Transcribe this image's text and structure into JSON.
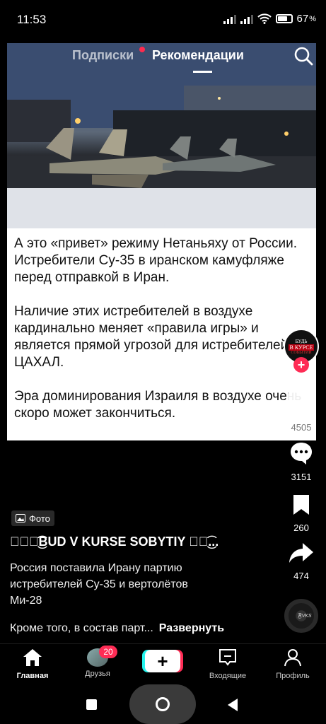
{
  "status_bar": {
    "time": "11:53",
    "battery": "67"
  },
  "tabs": {
    "subscriptions": "Подписки",
    "recommendations": "Рекомендации",
    "active": "recommendations"
  },
  "post": {
    "paragraphs": [
      "А это «привет» режиму Нетаньяху от России. Истребители Су-35 в иранском камуфляже перед отправкой в Иран.",
      "Наличие этих истребителей в воздухе кардинально меняет «правила игры» и является прямой угрозой для истребителей ЦАХАЛ.",
      "Эра доминирования Израиля в воздухе очень скоро может закончиться."
    ]
  },
  "rail": {
    "avatar_text": [
      "БУДЬ",
      "В КУРСЕ",
      "СОБЫТИЙ"
    ],
    "likes": "4505",
    "comments": "3151",
    "saves": "260",
    "shares": "474"
  },
  "caption": {
    "badge": "Фото",
    "author": "⪩ঔৣ͜͡BUD V KURSE SOBYTIY ঔৣ͜͡...",
    "text": "Россия поставила Ирану партию истребителей Су-35 и вертолётов Ми-28",
    "more_text": "Кроме того, в состав парт...",
    "expand": "Развернуть"
  },
  "music": {
    "label": "ঔৣ͜͡BVKS"
  },
  "bottom_nav": {
    "home": "Главная",
    "friends": "Друзья",
    "friends_badge": "20",
    "create": "+",
    "inbox": "Входящие",
    "profile": "Профиль"
  },
  "colors": {
    "accent": "#fe2c55",
    "cyan": "#25f4ee"
  }
}
